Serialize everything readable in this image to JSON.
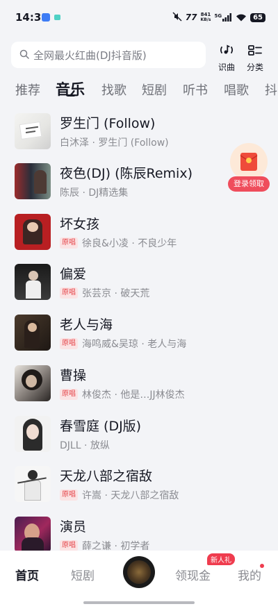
{
  "status_bar": {
    "time": "14:31",
    "speed_value": "841",
    "speed_unit": "KB/s",
    "network": "5G",
    "battery": "65"
  },
  "header": {
    "search_placeholder": "全网最火红曲(DJ抖音版)",
    "identify_label": "识曲",
    "category_label": "分类"
  },
  "tabs": [
    {
      "label": "推荐"
    },
    {
      "label": "音乐"
    },
    {
      "label": "找歌"
    },
    {
      "label": "短剧"
    },
    {
      "label": "听书"
    },
    {
      "label": "唱歌"
    },
    {
      "label": "抖"
    }
  ],
  "songs": [
    {
      "title": "罗生门 (Follow)",
      "badge": "",
      "subtitle": "白沐泽 · 罗生门 (Follow)"
    },
    {
      "title": "夜色(DJ) (陈辰Remix)",
      "badge": "",
      "subtitle": "陈辰 · DJ精选集"
    },
    {
      "title": "坏女孩",
      "badge": "原唱",
      "subtitle": "徐良&小凌 · 不良少年"
    },
    {
      "title": "偏爱",
      "badge": "原唱",
      "subtitle": "张芸京 · 破天荒"
    },
    {
      "title": "老人与海",
      "badge": "原唱",
      "subtitle": "海鸣威&吴琼 · 老人与海"
    },
    {
      "title": "曹操",
      "badge": "原唱",
      "subtitle": "林俊杰 · 他是…JJ林俊杰"
    },
    {
      "title": "春雪庭 (DJ版)",
      "badge": "",
      "subtitle": "DJLL · 放纵"
    },
    {
      "title": "天龙八部之宿敌",
      "badge": "原唱",
      "subtitle": "许嵩 · 天龙八部之宿敌"
    },
    {
      "title": "演员",
      "badge": "原唱",
      "subtitle": "薛之谦 · 初学者"
    }
  ],
  "floating_packet": {
    "label": "登录领取"
  },
  "bottom_nav": {
    "home": "首页",
    "drama": "短剧",
    "cash": "领现金",
    "cash_badge": "新人礼",
    "mine": "我的"
  },
  "colors": {
    "background": "#f3f4f7",
    "text_primary": "#161823",
    "text_secondary": "#8a8b91",
    "badge_red": "#e5474b",
    "accent_red": "#ef4d5c"
  }
}
